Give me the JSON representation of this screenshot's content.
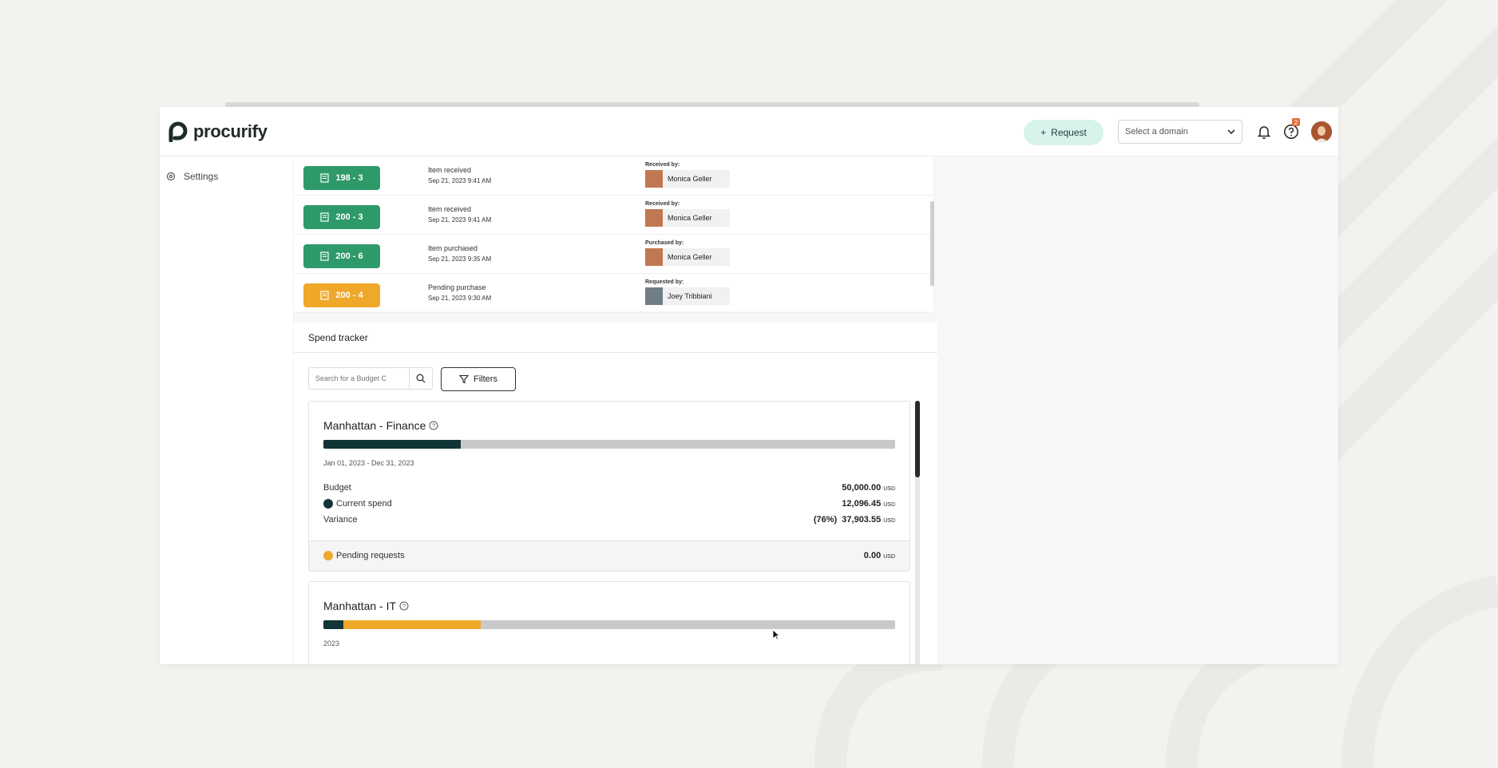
{
  "brand": {
    "name": "procurify"
  },
  "header": {
    "request_label": "Request",
    "domain_select": {
      "value": "Select a domain"
    },
    "help_badge": "2"
  },
  "sidebar": {
    "items": [
      {
        "label": "Settings",
        "icon": "gear-icon"
      }
    ]
  },
  "activity": {
    "rows": [
      {
        "badge": "198 - 3",
        "status": "green",
        "title": "Item received",
        "date": "Sep 21, 2023 9:41 AM",
        "by_label": "Received by:",
        "person": "Monica Geller"
      },
      {
        "badge": "200 - 3",
        "status": "green",
        "title": "Item received",
        "date": "Sep 21, 2023 9:41 AM",
        "by_label": "Received by:",
        "person": "Monica Geller"
      },
      {
        "badge": "200 - 6",
        "status": "green",
        "title": "Item purchased",
        "date": "Sep 21, 2023 9:35 AM",
        "by_label": "Purchased by:",
        "person": "Monica Geller"
      },
      {
        "badge": "200 - 4",
        "status": "orange",
        "title": "Pending purchase",
        "date": "Sep 21, 2023 9:30 AM",
        "by_label": "Requested by:",
        "person": "Joey Tribbiani"
      }
    ]
  },
  "spend_tracker": {
    "title": "Spend tracker",
    "search_placeholder": "Search for a Budget C",
    "filters_label": "Filters",
    "budgets": [
      {
        "name": "Manhattan - Finance",
        "dates": "Jan 01, 2023 - Dec 31, 2023",
        "spent_fraction": 0.24,
        "pending_fraction": 0,
        "budget_label": "Budget",
        "budget_value": "50,000.00",
        "current_label": "Current spend",
        "current_value": "12,096.45",
        "variance_label": "Variance",
        "variance_value": "(76%)  37,903.55",
        "pending_label": "Pending requests",
        "pending_value": "0.00",
        "currency": "USD"
      },
      {
        "name": "Manhattan - IT",
        "dates": "2023",
        "spent_fraction": 0.035,
        "pending_fraction": 0.24
      }
    ]
  },
  "colors": {
    "accent_green": "#2e9a6a",
    "pending_orange": "#f0a82a",
    "spend_dark": "#113536",
    "request_button_bg": "#d8f3ec"
  }
}
